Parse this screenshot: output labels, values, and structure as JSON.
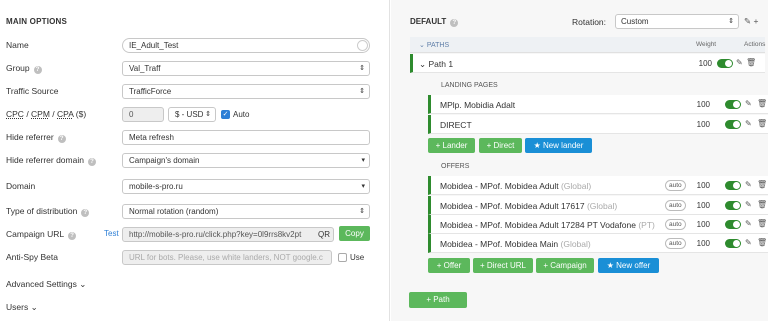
{
  "left": {
    "section_title": "MAIN OPTIONS",
    "name": {
      "label": "Name",
      "value": "IE_Adult_Test"
    },
    "group": {
      "label": "Group",
      "value": "Val_Traff"
    },
    "traffic_source": {
      "label": "Traffic Source",
      "value": "TrafficForce"
    },
    "cost": {
      "label_cpc": "CPC",
      "sep1": " / ",
      "label_cpm": "CPM",
      "sep2": " / ",
      "label_cpa": "CPA",
      "suffix": " ($)",
      "value": "0",
      "currency": "$ - USD",
      "auto_label": "Auto",
      "auto_checked": true
    },
    "hide_referrer": {
      "label": "Hide referrer",
      "value": "Meta refresh"
    },
    "hide_referrer_domain": {
      "label": "Hide referrer domain",
      "value": "Campaign's domain"
    },
    "domain": {
      "label": "Domain",
      "value": "mobile-s-pro.ru"
    },
    "distribution": {
      "label": "Type of distribution",
      "value": "Normal rotation (random)"
    },
    "campaign_url": {
      "label": "Campaign URL",
      "test": "Test",
      "value": "http://mobile-s-pro.ru/click.php?key=0l9rrs8kv2pt",
      "qr": "QR",
      "copy": "Copy"
    },
    "anti_spy": {
      "label": "Anti-Spy Beta",
      "placeholder": "URL for bots. Please, use white landers, NOT google.c",
      "use_label": "Use"
    },
    "advanced": "Advanced Settings",
    "users": "Users"
  },
  "right": {
    "title": "DEFAULT",
    "rotation_label": "Rotation:",
    "rotation_value": "Custom",
    "paths_header": "PATHS",
    "weight_header": "Weight",
    "actions_header": "Actions",
    "path": {
      "name": "Path 1",
      "weight": "100"
    },
    "landing_title": "LANDING PAGES",
    "landers": [
      {
        "name": "MPlp. Mobidia Adalt",
        "weight": "100"
      },
      {
        "name": "DIRECT",
        "weight": "100"
      }
    ],
    "lander_buttons": {
      "add_lander": "+ Lander",
      "add_direct": "+ Direct",
      "new_lander": "★ New lander"
    },
    "offers_title": "OFFERS",
    "offers": [
      {
        "name": "Mobidea - MPof. Mobidea Adult",
        "geo": "(Global)",
        "auto": "auto",
        "weight": "100"
      },
      {
        "name": "Mobidea - MPof. Mobidea Adult 17617",
        "geo": "(Global)",
        "auto": "auto",
        "weight": "100"
      },
      {
        "name": "Mobidea - MPof. Mobidea Adult 17284 PT Vodafone",
        "geo": "(PT)",
        "auto": "auto",
        "weight": "100"
      },
      {
        "name": "Mobidea - MPof. Mobidea Main",
        "geo": "(Global)",
        "auto": "auto",
        "weight": "100"
      }
    ],
    "offer_buttons": {
      "add_offer": "+ Offer",
      "add_direct_url": "+ Direct URL",
      "add_campaign": "+ Campaign",
      "new_offer": "★ New offer"
    },
    "add_path": "+ Path"
  }
}
